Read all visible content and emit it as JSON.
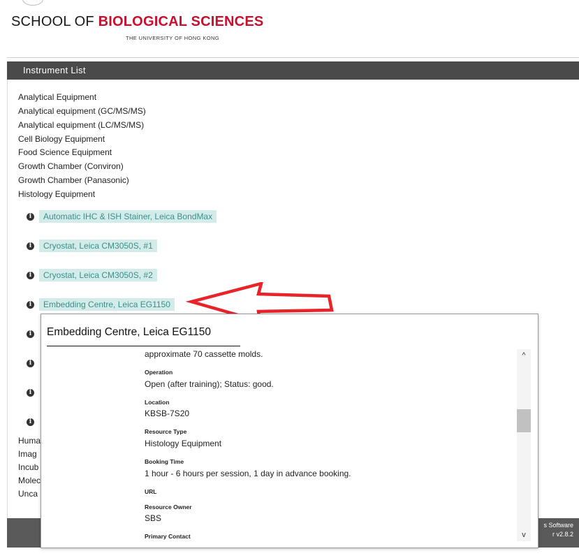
{
  "header": {
    "logo_prefix": "SCHOOL OF ",
    "logo_emphasis": "BIOLOGICAL SCIENCES",
    "logo_subtitle": "THE UNIVERSITY OF HONG KONG"
  },
  "panel": {
    "title": "Instrument List"
  },
  "categories": [
    "Analytical Equipment",
    "Analytical equipment (GC/MS/MS)",
    "Analytical equipment (LC/MS/MS)",
    "Cell Biology Equipment",
    "Food Science Equipment",
    "Growth Chamber (Conviron)",
    "Growth Chamber (Panasonic)",
    "Histology Equipment"
  ],
  "instruments": [
    "Automatic IHC & ISH Stainer, Leica BondMax",
    "Cryostat, Leica CM3050S, #1",
    "Cryostat, Leica CM3050S, #2",
    "Embedding Centre, Leica EG1150"
  ],
  "info_icon_glyph": "i",
  "categories_after": [
    "Huma",
    "Imag",
    "Incub",
    "Molec",
    "Unca"
  ],
  "popup": {
    "title": "Embedding Centre, Leica EG1150",
    "intro": "approximate 70 cassette molds.",
    "fields": {
      "operation": {
        "label": "Operation",
        "value": "Open (after training); Status: good."
      },
      "location": {
        "label": "Location",
        "value": "KBSB-7S20"
      },
      "resource_type": {
        "label": "Resource Type",
        "value": "Histology Equipment"
      },
      "booking_time": {
        "label": "Booking Time",
        "value": "1 hour - 6 hours per session, 1 day in advance booking."
      },
      "url": {
        "label": "URL"
      },
      "resource_owner": {
        "label": "Resource Owner",
        "value": "SBS"
      },
      "primary_contact": {
        "label": "Primary Contact"
      }
    },
    "scroll_up_glyph": "^",
    "scroll_down_glyph": "v"
  },
  "footer": {
    "line1": "s Software",
    "line2": "r v2.8.2"
  },
  "colors": {
    "title_bar": "#4a4a4a",
    "logo_accent": "#c8102e",
    "instrument_bg": "#d4ece9",
    "instrument_text": "#3a8f8c",
    "annotation_arrow": "#e8232a"
  }
}
